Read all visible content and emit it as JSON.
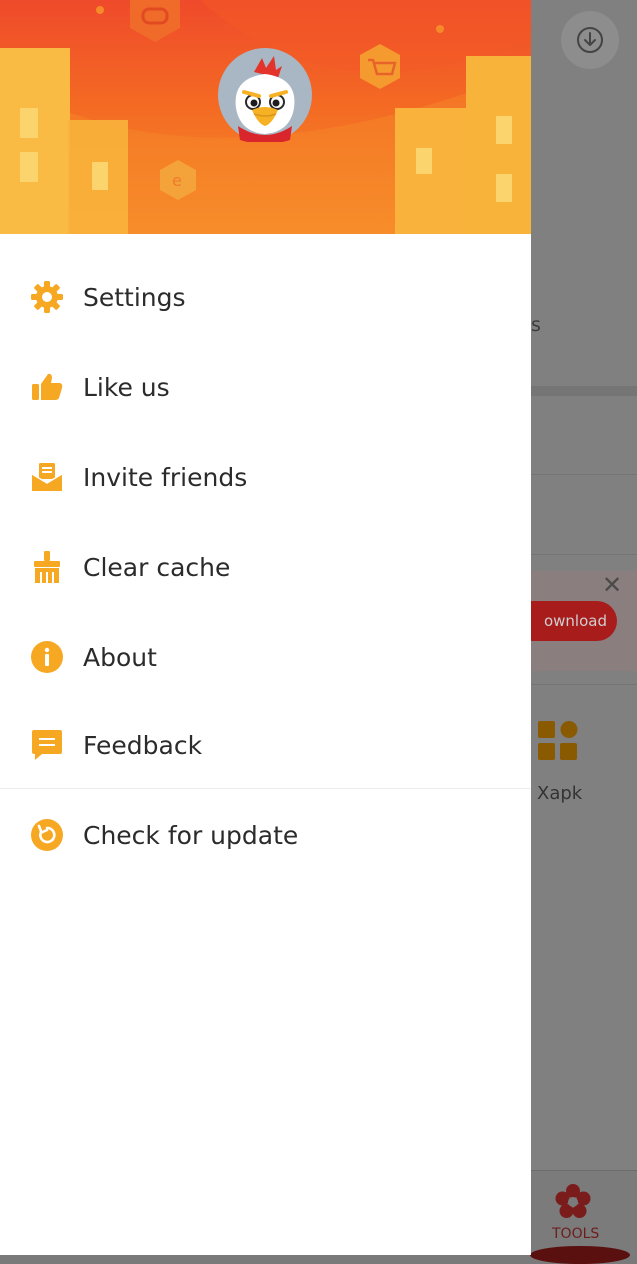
{
  "background": {
    "partial_text": "s",
    "download_button_label": "ownload",
    "close_glyph": "✕",
    "tool_label": "Xapk",
    "bottom_tab_label": "TOOLS"
  },
  "drawer": {
    "menu": [
      {
        "label": "Settings",
        "icon": "gear-icon"
      },
      {
        "label": "Like us",
        "icon": "thumbs-up-icon"
      },
      {
        "label": "Invite friends",
        "icon": "envelope-icon"
      },
      {
        "label": "Clear cache",
        "icon": "broom-icon"
      },
      {
        "label": "About",
        "icon": "info-icon"
      },
      {
        "label": "Feedback",
        "icon": "chat-icon"
      }
    ],
    "secondary": [
      {
        "label": "Check for update",
        "icon": "refresh-icon"
      }
    ]
  },
  "colors": {
    "accent": "#f7a823",
    "header_top": "#ef4a2b",
    "header_bottom": "#f7902a",
    "text": "#2b2b2b"
  }
}
